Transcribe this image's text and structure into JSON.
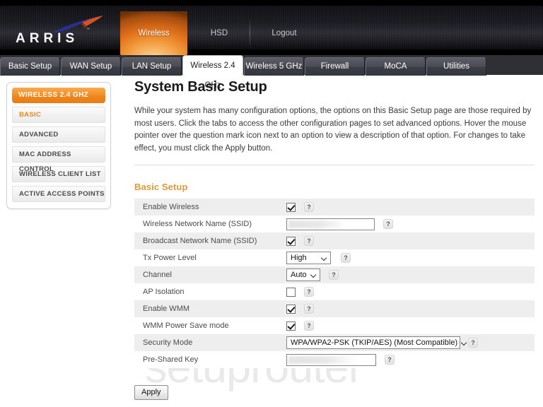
{
  "brand": {
    "logo_text": "ARRIS",
    "trademark": "™"
  },
  "top_nav": {
    "items": [
      {
        "label": "Wireless",
        "active": true
      },
      {
        "label": "HSD",
        "active": false
      },
      {
        "label": "Logout",
        "active": false
      }
    ]
  },
  "tabs": [
    {
      "label": "Basic Setup",
      "active": false
    },
    {
      "label": "WAN Setup",
      "active": false
    },
    {
      "label": "LAN Setup",
      "active": false
    },
    {
      "label": "Wireless 2.4 GHz",
      "active": true
    },
    {
      "label": "Wireless 5 GHz",
      "active": false
    },
    {
      "label": "Firewall",
      "active": false
    },
    {
      "label": "MoCA",
      "active": false
    },
    {
      "label": "Utilities",
      "active": false
    }
  ],
  "sidebar": {
    "header": "WIRELESS 2.4 GHZ",
    "items": [
      {
        "label": "BASIC",
        "active": true
      },
      {
        "label": "ADVANCED",
        "active": false
      },
      {
        "label": "MAC ADDRESS CONTROL",
        "active": false
      },
      {
        "label": "WIRELESS CLIENT LIST",
        "active": false
      },
      {
        "label": "ACTIVE ACCESS POINTS",
        "active": false
      }
    ]
  },
  "main": {
    "title": "System Basic Setup",
    "description": "While your system has many configuration options, the options on this Basic Setup page are those required by most users. Click the tabs to access the other configuration pages to set advanced options. Hover the mouse pointer over the question mark icon next to an option to view a description of that option. For changes to take effect, you must click the Apply button.",
    "section_title": "Basic Setup",
    "help_glyph": "?",
    "rows": [
      {
        "label": "Enable Wireless",
        "type": "checkbox",
        "checked": true
      },
      {
        "label": "Wireless Network Name (SSID)",
        "type": "text",
        "value": "",
        "redacted": true
      },
      {
        "label": "Broadcast Network Name (SSID)",
        "type": "checkbox",
        "checked": true
      },
      {
        "label": "Tx Power Level",
        "type": "select",
        "value": "High"
      },
      {
        "label": "Channel",
        "type": "select",
        "value": "Auto"
      },
      {
        "label": "AP Isolation",
        "type": "checkbox",
        "checked": false
      },
      {
        "label": "Enable WMM",
        "type": "checkbox",
        "checked": true
      },
      {
        "label": "WMM Power Save mode",
        "type": "checkbox",
        "checked": true
      },
      {
        "label": "Security Mode",
        "type": "select",
        "value": "WPA/WPA2-PSK (TKIP/AES) (Most Compatible)"
      },
      {
        "label": "Pre-Shared Key",
        "type": "text",
        "value": "",
        "redacted": true
      }
    ],
    "apply_label": "Apply"
  },
  "watermark": {
    "text": "setuprouter"
  },
  "colors": {
    "accent_orange": "#ef851c",
    "section_heading": "#e09a3a",
    "header_black": "#000000",
    "tab_gray": "#4a4c55",
    "row_alt": "#eeeeee"
  }
}
